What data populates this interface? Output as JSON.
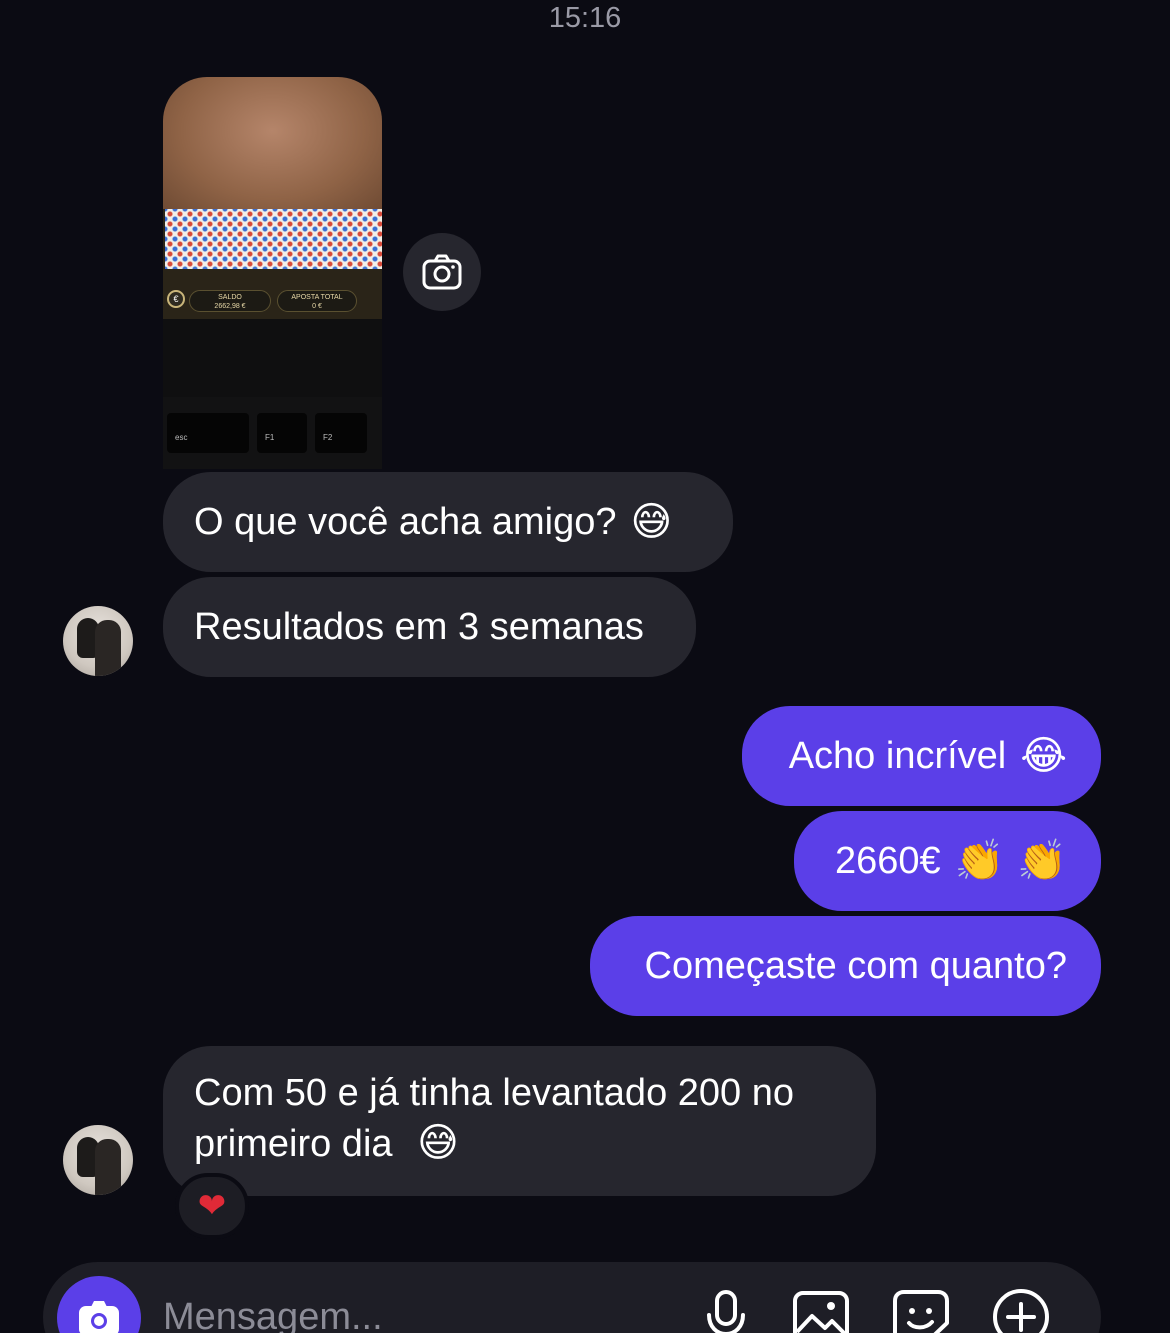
{
  "status": {
    "time": "15:16"
  },
  "media": {
    "saldo_label": "SALDO",
    "saldo_value": "2662,98 €",
    "aposta_label": "APOSTA TOTAL",
    "aposta_value": "0 €",
    "coin_symbol": "€",
    "key_esc": "esc",
    "key_f1": "F1",
    "key_f2": "F2"
  },
  "messages": [
    {
      "side": "incoming",
      "text": "O que você acha amigo?",
      "emoji": "😅"
    },
    {
      "side": "incoming",
      "text": "Resultados em 3 semanas"
    },
    {
      "side": "outgoing",
      "text": "Acho incrível",
      "emoji": "😂"
    },
    {
      "side": "outgoing",
      "text": "2660€",
      "emoji": "👏 👏"
    },
    {
      "side": "outgoing",
      "text": "Começaste com quanto?"
    },
    {
      "side": "incoming",
      "text_line1": "Com 50 e já tinha levantado 200 no",
      "text_line2": "primeiro dia",
      "emoji": "😅",
      "reaction": "❤"
    }
  ],
  "composer": {
    "placeholder": "Mensagem..."
  },
  "colors": {
    "background": "#0b0b13",
    "incoming_bubble": "#26262e",
    "outgoing_bubble": "#5b3fe8",
    "accent": "#5b3fe8"
  },
  "icons": [
    "camera-icon",
    "microphone-icon",
    "gallery-icon",
    "sticker-icon",
    "plus-icon"
  ]
}
